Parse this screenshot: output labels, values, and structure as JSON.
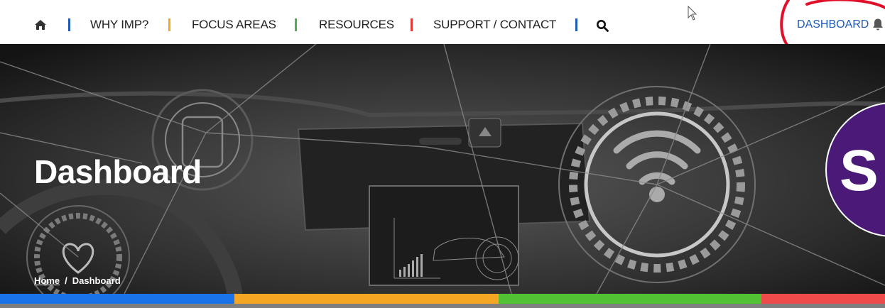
{
  "nav": {
    "items": [
      {
        "label": "WHY IMP?"
      },
      {
        "label": "FOCUS AREAS"
      },
      {
        "label": "RESOURCES"
      },
      {
        "label": "SUPPORT / CONTACT"
      }
    ],
    "separator_colors": [
      "#1e5bb8",
      "#f5a623",
      "#4caf50",
      "#e53935",
      "#1e5bb8"
    ],
    "dashboard_label": "DASHBOARD",
    "icons": {
      "home": "home-icon",
      "search": "search-icon",
      "bell": "bell-icon"
    }
  },
  "hero": {
    "title": "Dashboard",
    "badge_letter": "S",
    "breadcrumb": {
      "home": "Home",
      "separator": "/",
      "current": "Dashboard"
    }
  },
  "colors": {
    "stripe": [
      "#1a73e8",
      "#f5a623",
      "#52c234",
      "#ef4b4b"
    ],
    "annotation": "#e0102a",
    "link": "#1e5bb8",
    "badge": "#4b1a78"
  }
}
